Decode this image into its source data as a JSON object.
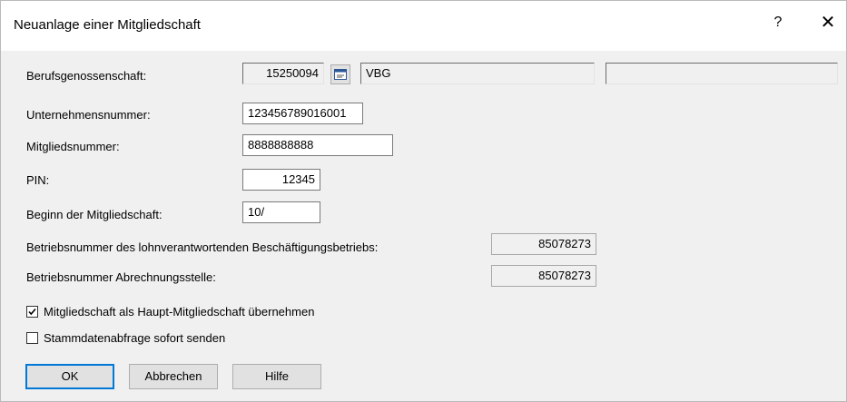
{
  "window": {
    "title": "Neuanlage einer Mitgliedschaft",
    "help_glyph": "?",
    "close_glyph": "✕"
  },
  "form": {
    "berufsgenossenschaft": {
      "label": "Berufsgenossenschaft:",
      "number": "15250094",
      "name": "VBG",
      "extra": ""
    },
    "unternehmensnummer": {
      "label": "Unternehmensnummer:",
      "value": "123456789016001"
    },
    "mitgliedsnummer": {
      "label": "Mitgliedsnummer:",
      "value": "8888888888"
    },
    "pin": {
      "label": "PIN:",
      "value": "12345"
    },
    "beginn": {
      "label": "Beginn der Mitgliedschaft:",
      "value": "10/"
    },
    "betriebsnummer_lohn": {
      "label": "Betriebsnummer des lohnverantwortenden Beschäftigungsbetriebs:",
      "value": "85078273"
    },
    "betriebsnummer_abrechnung": {
      "label": "Betriebsnummer Abrechnungsstelle:",
      "value": "85078273"
    }
  },
  "checkboxes": {
    "haupt": {
      "label": "Mitgliedschaft als Haupt-Mitgliedschaft übernehmen",
      "checked": true
    },
    "stammdaten": {
      "label": "Stammdatenabfrage sofort senden",
      "checked": false
    }
  },
  "buttons": {
    "ok": "OK",
    "cancel": "Abbrechen",
    "help": "Hilfe"
  },
  "icons": {
    "lookup": "calendar-lookup-icon",
    "check": "checkmark-icon"
  },
  "colors": {
    "accent": "#0078d7",
    "dialog_bg": "#f0f0f0",
    "titlebar_bg": "#ffffff"
  }
}
